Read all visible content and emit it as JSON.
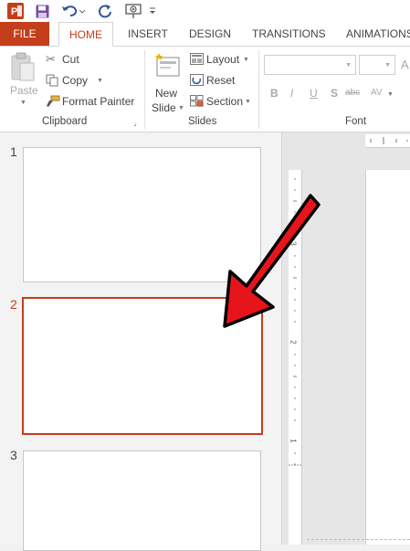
{
  "quick_access": {
    "app_icon": "powerpoint-logo",
    "icons": [
      "save-icon",
      "undo-icon",
      "repeat-icon",
      "slideshow-from-beginning-icon",
      "customize-toolbar-icon"
    ]
  },
  "tabs": {
    "file": "FILE",
    "home": "HOME",
    "insert": "INSERT",
    "design": "DESIGN",
    "transitions": "TRANSITIONS",
    "animations": "ANIMATIONS"
  },
  "ribbon": {
    "clipboard": {
      "paste": "Paste",
      "cut": "Cut",
      "copy": "Copy",
      "format_painter": "Format Painter",
      "label": "Clipboard"
    },
    "slides": {
      "new_slide_line1": "New",
      "new_slide_line2": "Slide",
      "layout": "Layout",
      "reset": "Reset",
      "section": "Section",
      "label": "Slides"
    },
    "font": {
      "label": "Font",
      "font_name_value": "",
      "font_size_value": "",
      "grow_label": "A",
      "bold": "B",
      "italic": "I",
      "underline": "U",
      "shadow": "S",
      "strikethrough": "abc",
      "spacing": "AV"
    }
  },
  "thumbnails": [
    {
      "number": "1",
      "selected": false
    },
    {
      "number": "2",
      "selected": true
    },
    {
      "number": "3",
      "selected": false
    }
  ],
  "ruler": {
    "vertical_numbers": [
      "3",
      "2",
      "1"
    ]
  },
  "annotation": {
    "arrow_color": "#e8141b",
    "points_to": "slide-2"
  },
  "colors": {
    "accent": "#c43e1c",
    "arrow": "#e8141b"
  }
}
